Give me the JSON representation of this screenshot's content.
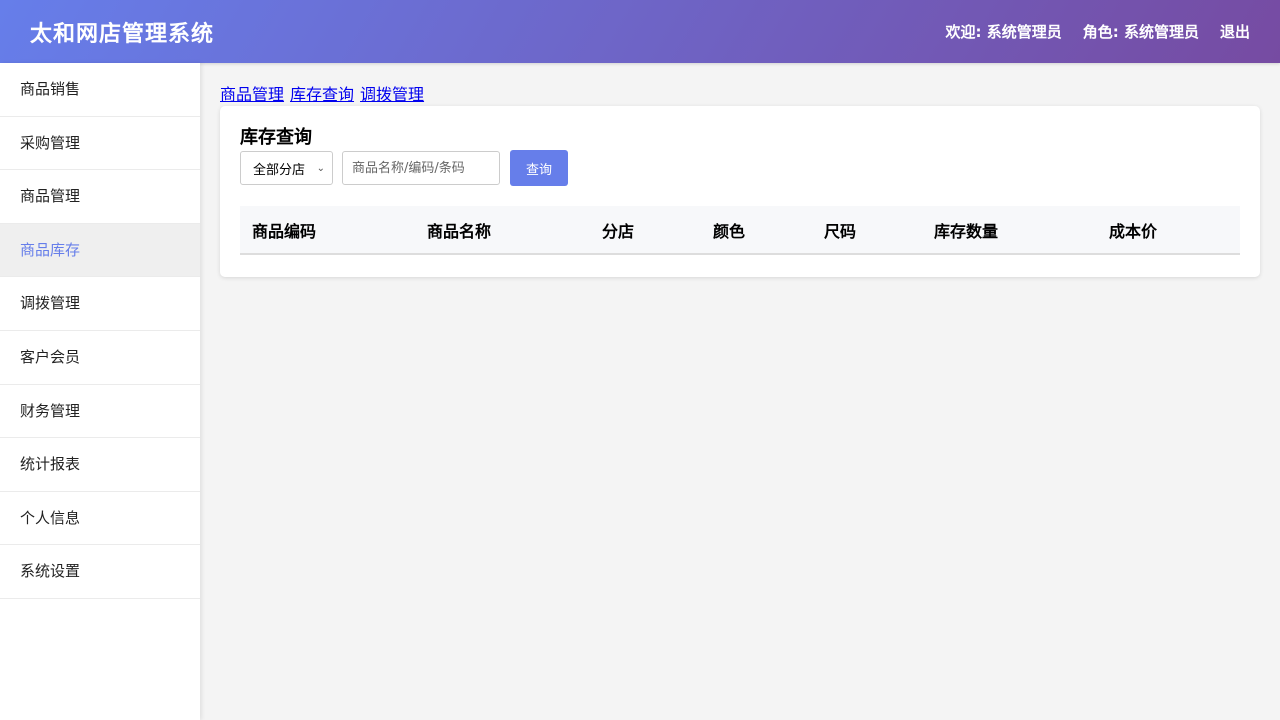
{
  "header": {
    "title": "太和网店管理系统",
    "welcome": "欢迎: 系统管理员",
    "role": "角色: 系统管理员",
    "logout": "退出"
  },
  "sidebar": {
    "items": [
      {
        "label": "商品销售"
      },
      {
        "label": "采购管理"
      },
      {
        "label": "商品管理"
      },
      {
        "label": "商品库存"
      },
      {
        "label": "调拨管理"
      },
      {
        "label": "客户会员"
      },
      {
        "label": "财务管理"
      },
      {
        "label": "统计报表"
      },
      {
        "label": "个人信息"
      },
      {
        "label": "系统设置"
      }
    ],
    "active_index": 3
  },
  "breadcrumbs": [
    "商品管理",
    "库存查询",
    "调拨管理"
  ],
  "card": {
    "title": "库存查询",
    "store_select": {
      "selected": "全部分店"
    },
    "search": {
      "placeholder": "商品名称/编码/条码",
      "value": ""
    },
    "query_button": "查询"
  },
  "table": {
    "columns": [
      "商品编码",
      "商品名称",
      "分店",
      "颜色",
      "尺码",
      "库存数量",
      "成本价"
    ],
    "rows": []
  },
  "colors": {
    "accent": "#667eea",
    "header_gradient_end": "#764ba2"
  }
}
